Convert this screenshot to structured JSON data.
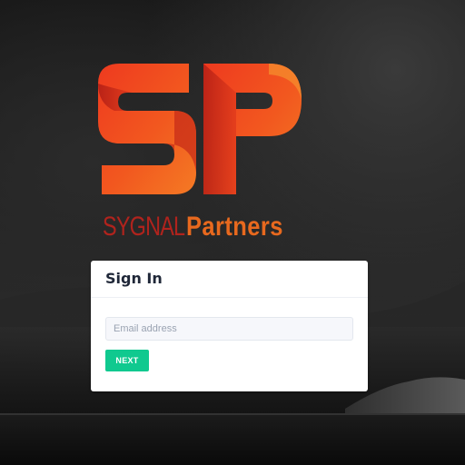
{
  "brand": {
    "monogram": "SP",
    "name_part1": "SYGNAL",
    "name_part2": "Partners",
    "color_primary": "#e8691e",
    "color_secondary": "#b0231d"
  },
  "signin": {
    "title": "Sign In",
    "email_placeholder": "Email address",
    "email_value": "",
    "next_label": "NEXT"
  },
  "colors": {
    "button": "#10c98f",
    "card": "#ffffff",
    "title_text": "#1f2738"
  }
}
